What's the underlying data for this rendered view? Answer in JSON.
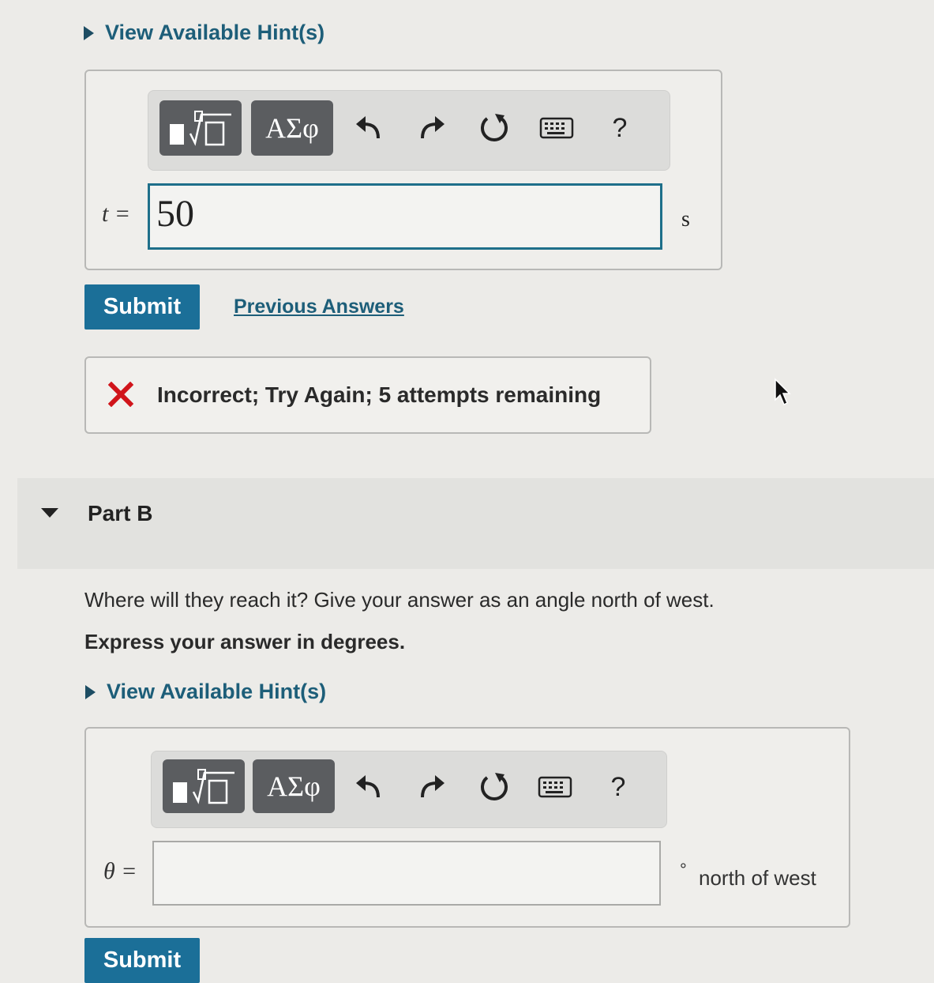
{
  "part_a": {
    "hint_label": "View Available Hint(s)",
    "toolbar": {
      "template_label": "▮√▯",
      "greek_label": "ΑΣφ",
      "undo_icon": "undo-icon",
      "redo_icon": "redo-icon",
      "reset_icon": "reset-icon",
      "keyboard_icon": "keyboard-icon",
      "help_label": "?"
    },
    "variable": "t =",
    "answer_value": "50",
    "unit": "s",
    "submit_label": "Submit",
    "previous_answers_label": "Previous Answers",
    "feedback": {
      "icon": "x-icon",
      "text": "Incorrect; Try Again; 5 attempts remaining"
    }
  },
  "part_b": {
    "title": "Part B",
    "question": "Where will they reach it? Give your answer as an angle north of west.",
    "instruction": "Express your answer in degrees.",
    "hint_label": "View Available Hint(s)",
    "toolbar": {
      "template_label": "▮√▯",
      "greek_label": "ΑΣφ",
      "help_label": "?"
    },
    "variable": "θ =",
    "answer_value": "",
    "unit_symbol": "°",
    "unit": "north of west",
    "submit_label": "Submit"
  },
  "colors": {
    "accent": "#1b6f98",
    "link": "#1d5e79",
    "error": "#d0141a",
    "background": "#ecebe8"
  }
}
